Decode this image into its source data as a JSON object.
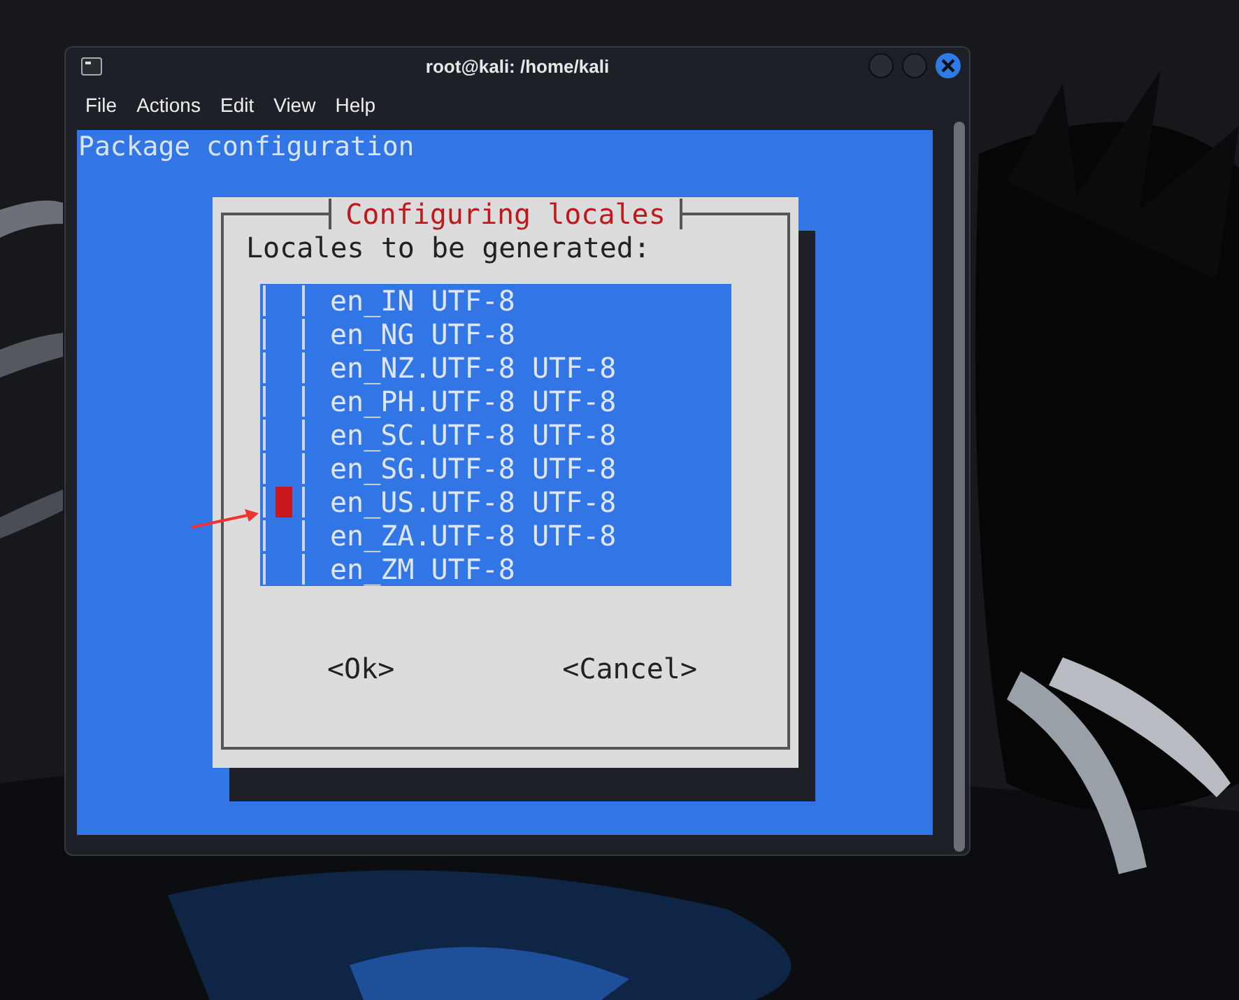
{
  "window": {
    "title": "root@kali: /home/kali"
  },
  "menu": [
    "File",
    "Actions",
    "Edit",
    "View",
    "Help"
  ],
  "terminal": {
    "header": "Package configuration"
  },
  "dialog": {
    "title": "Configuring locales",
    "prompt": "Locales to be generated:",
    "items": [
      {
        "label": "en_IN UTF-8",
        "checked": false,
        "selected": false
      },
      {
        "label": "en_NG UTF-8",
        "checked": false,
        "selected": false
      },
      {
        "label": "en_NZ.UTF-8 UTF-8",
        "checked": false,
        "selected": false
      },
      {
        "label": "en_PH.UTF-8 UTF-8",
        "checked": false,
        "selected": false
      },
      {
        "label": "en_SC.UTF-8 UTF-8",
        "checked": false,
        "selected": false
      },
      {
        "label": "en_SG.UTF-8 UTF-8",
        "checked": false,
        "selected": false
      },
      {
        "label": "en_US.UTF-8 UTF-8",
        "checked": false,
        "selected": true
      },
      {
        "label": "en_ZA.UTF-8 UTF-8",
        "checked": false,
        "selected": false
      },
      {
        "label": "en_ZM UTF-8",
        "checked": false,
        "selected": false
      }
    ],
    "buttons": [
      "<Ok>",
      "<Cancel>"
    ]
  }
}
